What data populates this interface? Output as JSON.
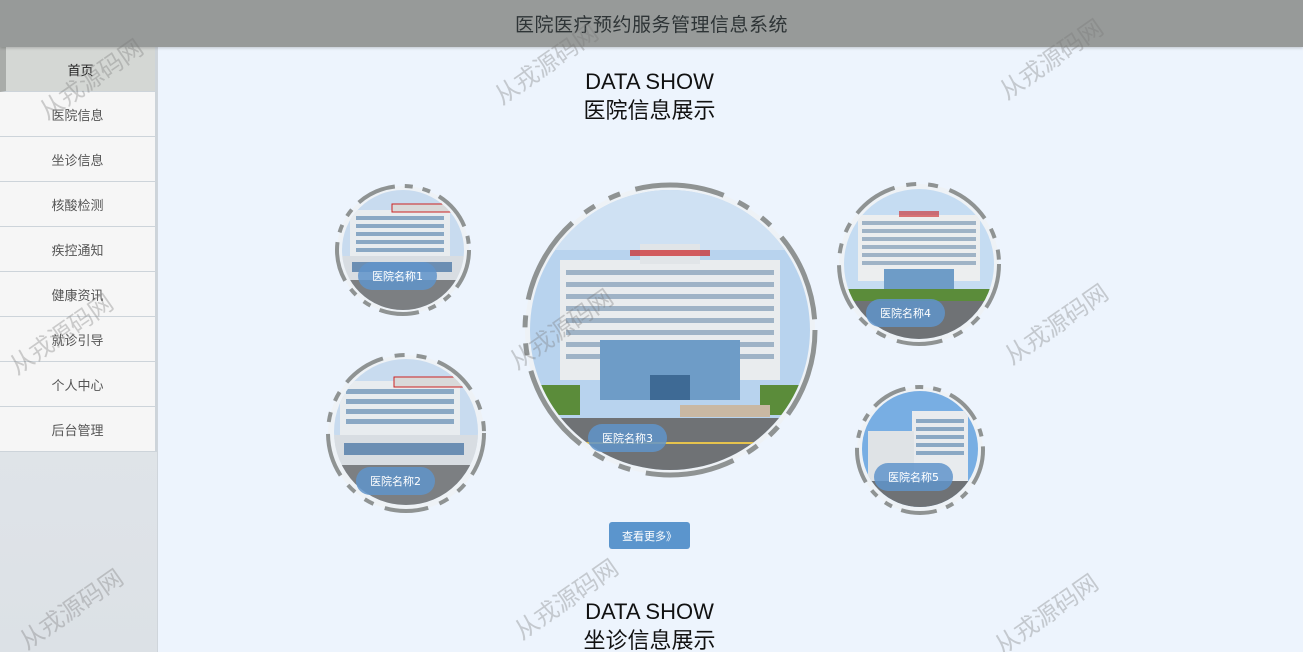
{
  "header": {
    "title": "医院医疗预约服务管理信息系统"
  },
  "sidebar": {
    "items": [
      {
        "label": "首页",
        "active": true
      },
      {
        "label": "医院信息"
      },
      {
        "label": "坐诊信息"
      },
      {
        "label": "核酸检测"
      },
      {
        "label": "疾控通知"
      },
      {
        "label": "健康资讯"
      },
      {
        "label": "就诊引导"
      },
      {
        "label": "个人中心"
      },
      {
        "label": "后台管理"
      }
    ]
  },
  "section1": {
    "title_en": "DATA SHOW",
    "title_cn": "医院信息展示",
    "hospitals": [
      {
        "name": "医院名称1"
      },
      {
        "name": "医院名称2"
      },
      {
        "name": "医院名称3"
      },
      {
        "name": "医院名称4"
      },
      {
        "name": "医院名称5"
      }
    ],
    "more_label": "查看更多》"
  },
  "section2": {
    "title_en": "DATA SHOW",
    "title_cn": "坐诊信息展示"
  },
  "watermark": {
    "text": "从戎源码网"
  },
  "colors": {
    "header_bg": "#979a99",
    "page_bg": "#edf4fd",
    "button": "#5b95cd"
  }
}
